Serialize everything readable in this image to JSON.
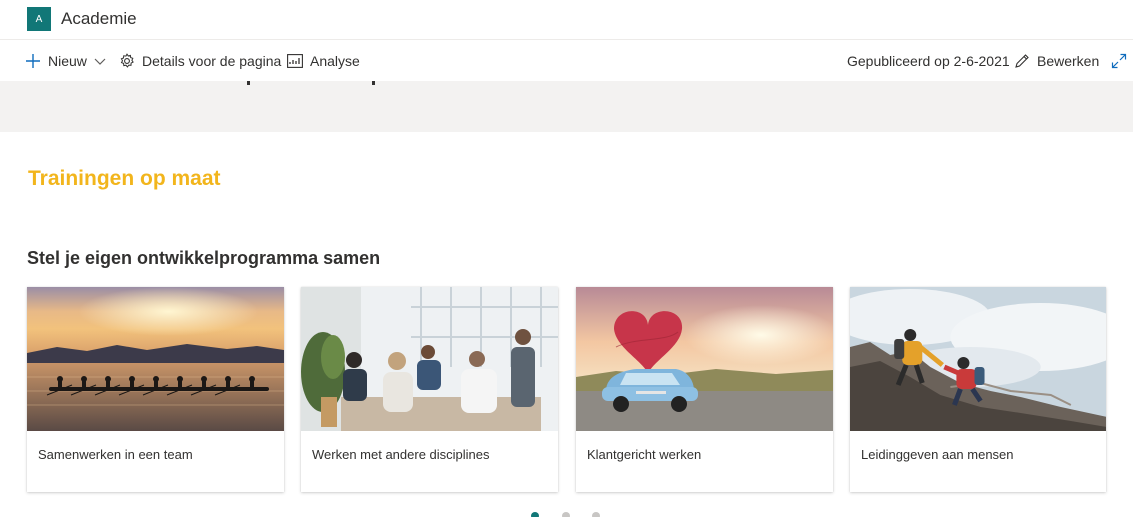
{
  "site": {
    "logo_letter": "A",
    "title": "Academie",
    "accent_color": "#117777"
  },
  "commandbar": {
    "new_label": "Nieuw",
    "details_label": "Details voor de pagina",
    "analyse_label": "Analyse",
    "published_text": "Gepubliceerd op 2-6-2021",
    "edit_label": "Bewerken",
    "icons": [
      "plus-icon",
      "chevron-down-icon",
      "gear-icon",
      "chart-icon",
      "pencil-icon",
      "expand-icon"
    ]
  },
  "main": {
    "section_title": "Trainingen op maat",
    "section_title_color": "#f2b51c",
    "subtitle": "Stel je eigen ontwikkelprogramma samen",
    "cards": [
      {
        "caption": "Samenwerken in een team",
        "image": "rowing-team-sunset-image"
      },
      {
        "caption": "Werken met andere disciplines",
        "image": "office-meeting-image"
      },
      {
        "caption": "Klantgericht werken",
        "image": "car-with-heart-image"
      },
      {
        "caption": "Leidinggeven aan mensen",
        "image": "climbers-helping-hand-image"
      }
    ],
    "carousel": {
      "pages": 3,
      "active_page": 1
    }
  }
}
